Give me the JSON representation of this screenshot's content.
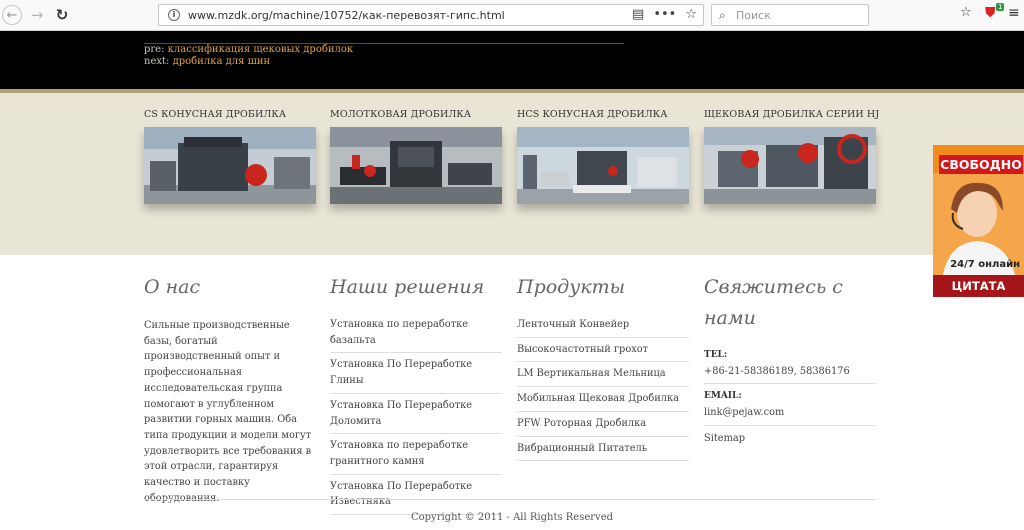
{
  "browser": {
    "url": "www.mzdk.org/machine/10752/как-перевозят-гипс.html",
    "search_placeholder": "Поиск",
    "badge_count": "1"
  },
  "nav": {
    "prev_prefix": "pre:",
    "prev_link": "классификация щековых дробилок",
    "next_prefix": "next:",
    "next_link": "дробилка для шин"
  },
  "products": [
    {
      "title": "CS КОНУСНАЯ ДРОБИЛКА"
    },
    {
      "title": "МОЛОТКОВАЯ ДРОБИЛКА"
    },
    {
      "title": "HCS КОНУСНАЯ ДРОБИЛКА"
    },
    {
      "title": "ЩЕКОВАЯ ДРОБИЛКА СЕРИИ HJ"
    }
  ],
  "ad": {
    "title": "СВОБОДНО",
    "hours": "24/7 онлайн",
    "cta": "ЦИТАТА"
  },
  "about": {
    "title": "О нас",
    "text": "Сильные производственные базы, богатый производственный опыт и профессиональная исследовательская группа помогают в углубленном развитии горных машин. Оба типа продукции и модели могут удовлетворить все требования в этой отрасли, гарантируя качество и поставку оборудования."
  },
  "solutions": {
    "title": "Наши решения",
    "items": [
      "Установка по переработке базальта",
      "Установка По Переработке Глины",
      "Установка По Переработке Доломита",
      "Установка по переработке гранитного камня",
      "Установка По Переработке Известняка"
    ]
  },
  "products_col": {
    "title": "Продукты",
    "items": [
      "Ленточный Конвейер",
      "Высокочастотный грохот",
      "LM Вертикальная Мельница",
      "Мобильная Щековая Дробилка",
      "PFW Роторная Дробилка",
      "Вибрационный Питатель"
    ]
  },
  "contact": {
    "title": "Свяжитесь с нами",
    "tel_label": "TEL:",
    "tel_value": "+86-21-58386189, 58386176",
    "email_label": "EMAIL:",
    "email_value": "link@pejaw.com",
    "sitemap": "Sitemap"
  },
  "footer": {
    "copyright": "Copyright © 2011 - All Rights Reserved"
  },
  "colors": {
    "link_accent": "#e0a341",
    "band_bg": "#e8e4d6",
    "ad_orange": "#f08c1b",
    "ad_red": "#d5171c"
  }
}
